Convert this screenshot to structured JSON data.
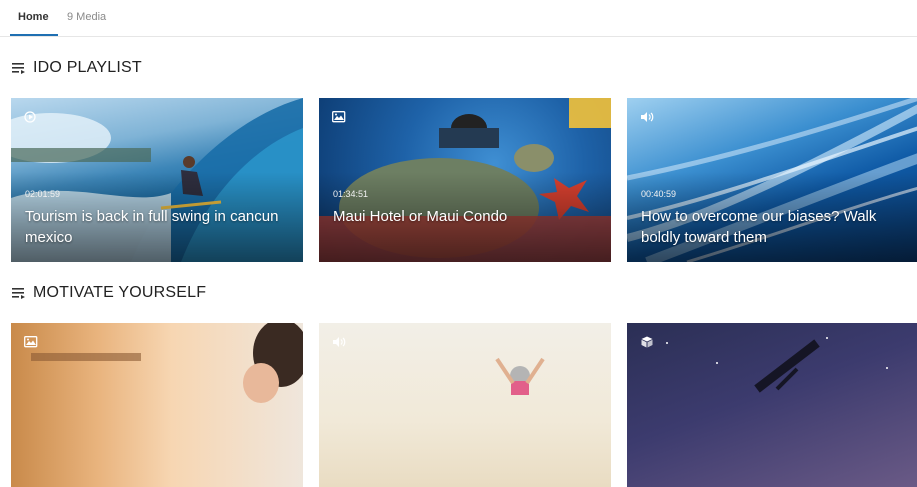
{
  "tabs": [
    {
      "label": "Home",
      "active": true
    },
    {
      "label": "9 Media",
      "active": false
    }
  ],
  "colors": {
    "accent": "#1f6fb2"
  },
  "sections": [
    {
      "title": "IDO PLAYLIST",
      "icon": "playlist-icon",
      "cards": [
        {
          "type_icon": "video-icon",
          "duration": "02:01:59",
          "title": "Tourism is back in full swing in cancun mexico"
        },
        {
          "type_icon": "image-icon",
          "duration": "01:34:51",
          "title": "Maui Hotel or Maui Condo"
        },
        {
          "type_icon": "audio-icon",
          "duration": "00:40:59",
          "title": "How to overcome our biases? Walk boldly toward them"
        }
      ]
    },
    {
      "title": "MOTIVATE YOURSELF",
      "icon": "playlist-icon",
      "cards": [
        {
          "type_icon": "image-icon"
        },
        {
          "type_icon": "audio-icon"
        },
        {
          "type_icon": "3d-cube-icon"
        }
      ]
    }
  ]
}
